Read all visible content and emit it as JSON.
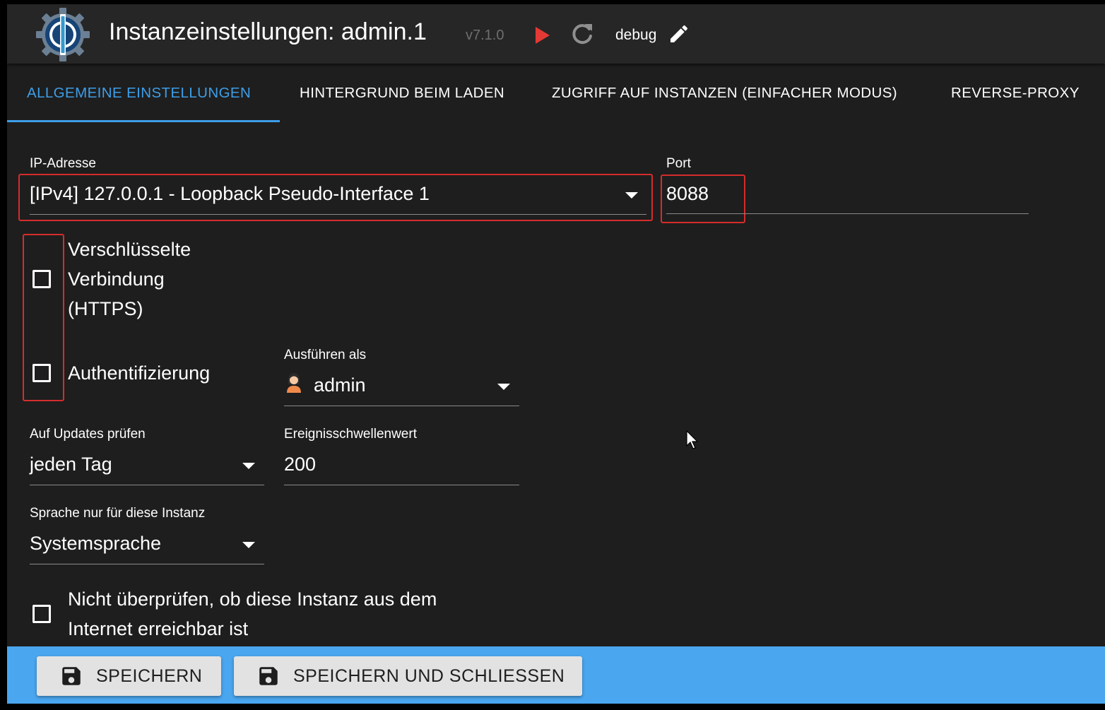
{
  "header": {
    "title": "Instanzeinstellungen: admin.1",
    "version": "v7.1.0",
    "mode_label": "debug",
    "icons": [
      "iobroker-logo-icon",
      "play-icon",
      "refresh-icon",
      "edit-icon"
    ],
    "colors": {
      "play": "#e53935",
      "accent": "#3d9ee8"
    }
  },
  "tabs": [
    {
      "label": "ALLGEMEINE EINSTELLUNGEN",
      "active": true
    },
    {
      "label": "HINTERGRUND BEIM LADEN",
      "active": false
    },
    {
      "label": "ZUGRIFF AUF INSTANZEN (EINFACHER MODUS)",
      "active": false
    },
    {
      "label": "REVERSE-PROXY",
      "active": false
    }
  ],
  "form": {
    "ip": {
      "label": "IP-Adresse",
      "value": "[IPv4] 127.0.0.1 - Loopback Pseudo-Interface 1"
    },
    "port": {
      "label": "Port",
      "value": "8088"
    },
    "https": {
      "label_lines": [
        "Verschlüsselte",
        "Verbindung",
        "(HTTPS)"
      ],
      "checked": false
    },
    "auth": {
      "label": "Authentifizierung",
      "checked": false
    },
    "run_as": {
      "label": "Ausführen als",
      "value": "admin",
      "icon": "user-avatar-icon"
    },
    "updates": {
      "label": "Auf Updates prüfen",
      "value": "jeden Tag"
    },
    "threshold": {
      "label": "Ereignisschwellenwert",
      "value": "200"
    },
    "language": {
      "label": "Sprache nur für diese Instanz",
      "value": "Systemsprache"
    },
    "no_check": {
      "label_lines": [
        "Nicht überprüfen, ob diese Instanz aus dem",
        "Internet erreichbar ist"
      ],
      "checked": false
    }
  },
  "footer": {
    "save_label": "SPEICHERN",
    "save_close_label": "SPEICHERN UND SCHLIESSEN",
    "save_icon": "floppy-disk-icon",
    "color": "#4aa6ef"
  }
}
